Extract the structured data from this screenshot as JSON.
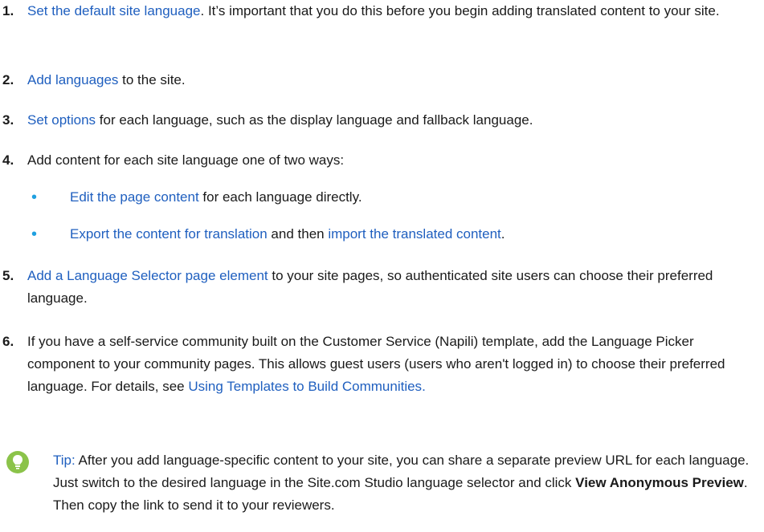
{
  "steps": [
    {
      "number": "1.",
      "link": "Set the default site language",
      "text": ". It’s important that you do this before you begin adding translated content to your site."
    },
    {
      "number": "2.",
      "link": "Add languages",
      "text": " to the site."
    },
    {
      "number": "3.",
      "link": "Set options",
      "text": " for each language, such as the display language and fallback language."
    },
    {
      "number": "4.",
      "text": "Add content for each site language one of two ways:",
      "substeps": [
        {
          "link": "Edit the page content",
          "text": " for each language directly."
        },
        {
          "link": "Export the content for translation",
          "middle": " and then ",
          "link2": "import the translated content",
          "end": "."
        }
      ]
    },
    {
      "number": "5.",
      "link": "Add a Language Selector page element",
      "text": " to your site pages, so authenticated site users can choose their preferred language."
    },
    {
      "number": "6.",
      "text": "If you have a self-service community built on the Customer Service (Napili) template, add the Language Picker component to your community pages. This allows guest users (users who aren't logged in) to choose their preferred language. For details, see ",
      "link": "Using Templates to Build Communities",
      "end": "."
    }
  ],
  "tip": {
    "label": "Tip:",
    "text": " After you add language-specific content to your site, you can share a separate preview URL for each language. Just switch to the desired language in the Site.com Studio language selector and click ",
    "bold": "View Anonymous Preview",
    "end": ". Then copy the link to send it to your reviewers.",
    "icon": "lightbulb-icon",
    "icon_color": "#8bc34a"
  },
  "colors": {
    "link": "#1f5fbf",
    "bullet": "#1fa0e0"
  }
}
